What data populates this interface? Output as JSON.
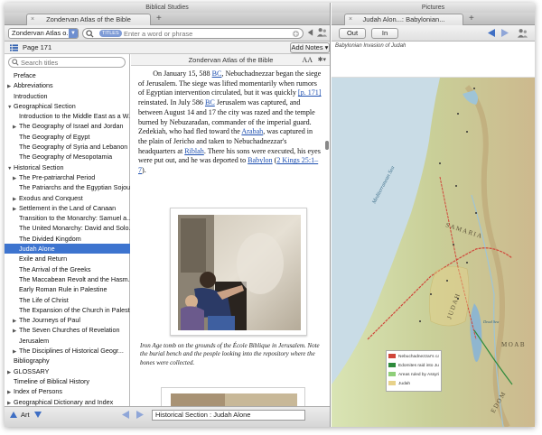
{
  "left": {
    "window_title": "Biblical Studies",
    "tab_label": "Zondervan Atlas of the Bible",
    "tab_close": "×",
    "tab_add": "+",
    "resource_select": "Zondervan Atlas o...",
    "search_scope": "TITLES",
    "search_placeholder": "Enter a word or phrase",
    "page_label": "Page 171",
    "add_notes": "Add Notes",
    "sidebar_search_placeholder": "Search titles",
    "toc": [
      {
        "label": "Preface",
        "indent": 0,
        "tri": ""
      },
      {
        "label": "Abbreviations",
        "indent": 0,
        "tri": "▶"
      },
      {
        "label": "Introduction",
        "indent": 0,
        "tri": ""
      },
      {
        "label": "Geographical Section",
        "indent": 0,
        "tri": "▼"
      },
      {
        "label": "Introduction to the Middle East as a W...",
        "indent": 1,
        "tri": ""
      },
      {
        "label": "The Geography of Israel and Jordan",
        "indent": 1,
        "tri": "▶"
      },
      {
        "label": "The Geography of Egypt",
        "indent": 1,
        "tri": ""
      },
      {
        "label": "The Geography of Syria and Lebanon",
        "indent": 1,
        "tri": ""
      },
      {
        "label": "The Geography of Mesopotamia",
        "indent": 1,
        "tri": ""
      },
      {
        "label": "Historical Section",
        "indent": 0,
        "tri": "▼"
      },
      {
        "label": "The Pre-patriarchal Period",
        "indent": 1,
        "tri": "▶"
      },
      {
        "label": "The Patriarchs and the Egyptian Sojourn",
        "indent": 1,
        "tri": ""
      },
      {
        "label": "Exodus and Conquest",
        "indent": 1,
        "tri": "▶"
      },
      {
        "label": "Settlement in the Land of Canaan",
        "indent": 1,
        "tri": "▶"
      },
      {
        "label": "Transition to the Monarchy: Samuel a...",
        "indent": 1,
        "tri": ""
      },
      {
        "label": "The United Monarchy: David and Solo...",
        "indent": 1,
        "tri": ""
      },
      {
        "label": "The Divided Kingdom",
        "indent": 1,
        "tri": ""
      },
      {
        "label": "Judah Alone",
        "indent": 1,
        "tri": "",
        "selected": true
      },
      {
        "label": "Exile and Return",
        "indent": 1,
        "tri": ""
      },
      {
        "label": "The Arrival of the Greeks",
        "indent": 1,
        "tri": ""
      },
      {
        "label": "The Maccabean Revolt and the Hasm...",
        "indent": 1,
        "tri": ""
      },
      {
        "label": "Early Roman Rule in Palestine",
        "indent": 1,
        "tri": ""
      },
      {
        "label": "The Life of Christ",
        "indent": 1,
        "tri": ""
      },
      {
        "label": "The Expansion of the Church in Palest...",
        "indent": 1,
        "tri": ""
      },
      {
        "label": "The Journeys of Paul",
        "indent": 1,
        "tri": "▶"
      },
      {
        "label": "The Seven Churches of Revelation",
        "indent": 1,
        "tri": "▶"
      },
      {
        "label": "Jerusalem",
        "indent": 1,
        "tri": ""
      },
      {
        "label": "The Disciplines of Historical Geogr...",
        "indent": 1,
        "tri": "▶"
      },
      {
        "label": "Bibliography",
        "indent": 0,
        "tri": ""
      },
      {
        "label": "GLOSSARY",
        "indent": 0,
        "tri": "▶"
      },
      {
        "label": "Timeline of Biblical History",
        "indent": 0,
        "tri": ""
      },
      {
        "label": "Index of Persons",
        "indent": 0,
        "tri": "▶"
      },
      {
        "label": "Geographical Dictionary and Index",
        "indent": 0,
        "tri": "▶"
      }
    ],
    "content_title": "Zondervan Atlas of the Bible",
    "font_size_label": "AA",
    "gear_label": "✱▾",
    "body": {
      "t1": "On January 15, 588 ",
      "l1": "BC",
      "t2": ", Nebuchadnezzar began the siege of Jerusalem. The siege was lifted momentarily when rumors of Egyptian intervention circulated, but it was quickly ",
      "l2": "[p. 171]",
      "t3": " reinstated. In July 586 ",
      "l3": "BC",
      "t4": " Jerusalem was captured, and between August 14 and 17 the city was razed and the temple burned by Nebuzaradan, commander of the imperial guard. Zedekiah, who had fled toward the ",
      "l4": "Arabah",
      "t5": ", was captured in the plain of Jericho and taken to Nebuchadnezzar's headquarters at ",
      "l5": "Riblah",
      "t6": ". There his sons were executed, his eyes were put out, and he was deported to ",
      "l6": "Babylon",
      "t7": " (",
      "l7": "2 Kings 25:1–7",
      "t8": ")."
    },
    "caption": "Iron Age tomb on the grounds of the École Biblique in Jerusalem. Note the burial bench and the people looking into the repository where the bones were collected.",
    "bottom_art": "Art",
    "status_text": "Historical Section : Judah Alone"
  },
  "right": {
    "window_title": "Pictures",
    "tab_label": "Judah Alon...: Babylonian...",
    "tab_close": "×",
    "tab_add": "+",
    "out_button": "Out",
    "in_button": "In",
    "map_caption": "Babylonian Invasion of Judah",
    "map_labels": {
      "sea": "Mediterranean Sea",
      "samaria": "SAMARIA",
      "judah": "JUDAH",
      "moab": "MOAB",
      "edom": "EDOM",
      "dead_sea": "Dead Sea"
    },
    "legend": [
      {
        "label": "Nebuchadnezzar's campaign",
        "color": "#d0463a"
      },
      {
        "label": "Edomites raid into Judah",
        "color": "#2e8b3c"
      },
      {
        "label": "Areas ruled by Assyrians",
        "color": "#8fcf7a"
      },
      {
        "label": "Judah",
        "color": "#e8d28a"
      }
    ]
  },
  "colors": {
    "selection": "#3d74cf",
    "link": "#1d4fb0"
  }
}
